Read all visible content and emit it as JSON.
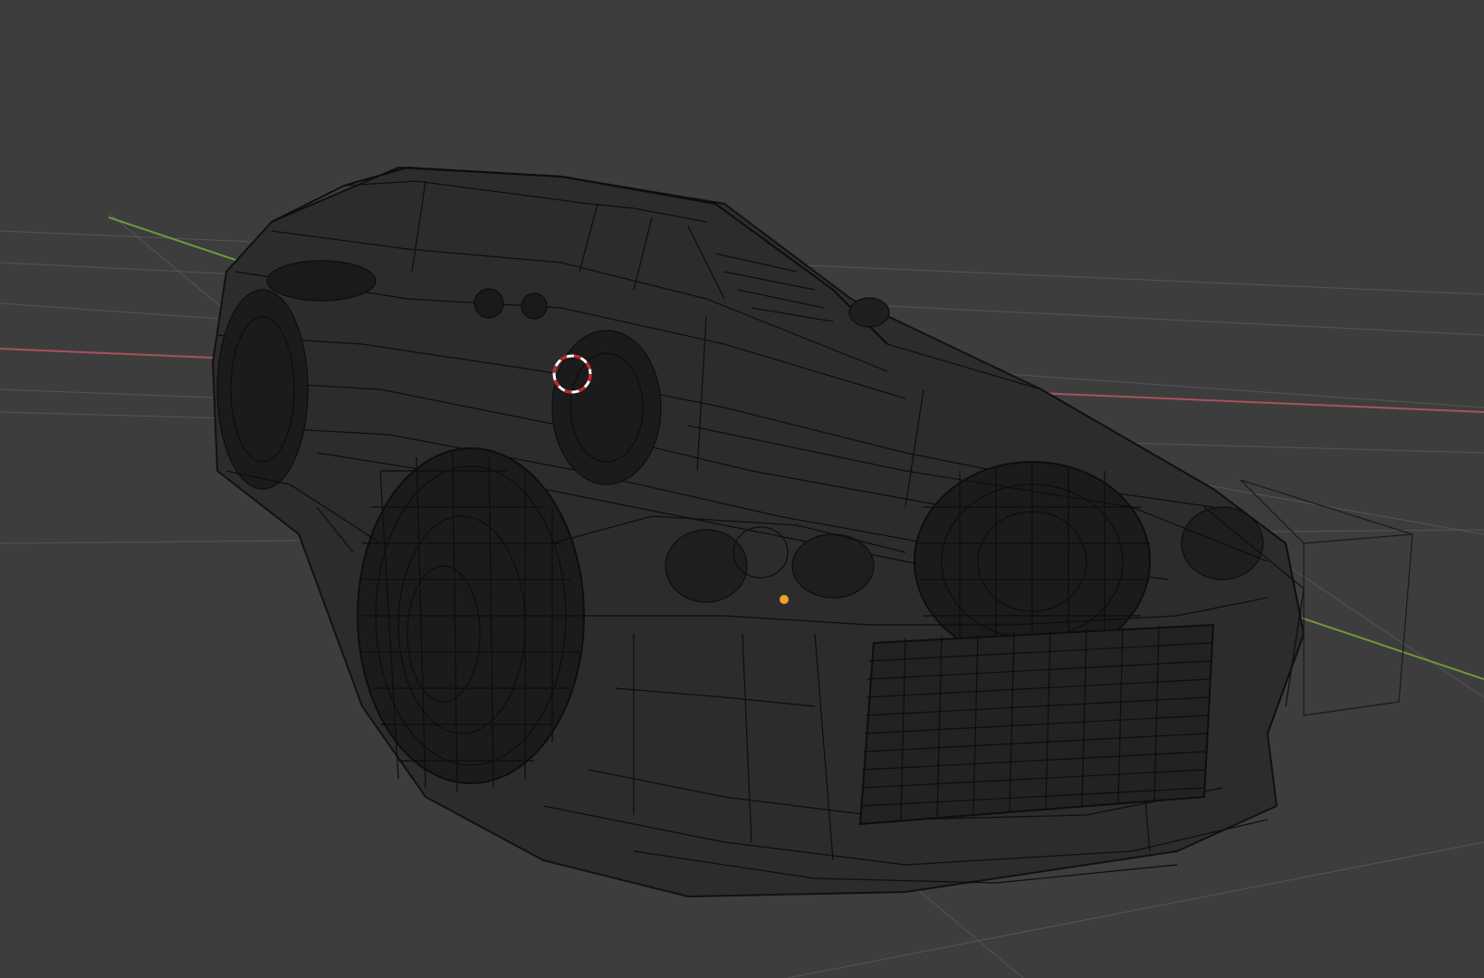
{
  "viewport": {
    "mode": "3d-viewport",
    "shading": "wireframe",
    "colors": {
      "background": "#3d3d3d",
      "grid": "#555555",
      "x_axis": "#a8525c",
      "y_axis": "#6f9a3a",
      "wireframe": "#0d0d0d",
      "wire_fill": "#1e1e1e",
      "origin_point": "#f0a030",
      "cursor_red": "#d02020",
      "cursor_white": "#ffffff"
    },
    "icons": {
      "cursor": "3d-cursor-icon",
      "origin": "object-origin-icon"
    }
  }
}
